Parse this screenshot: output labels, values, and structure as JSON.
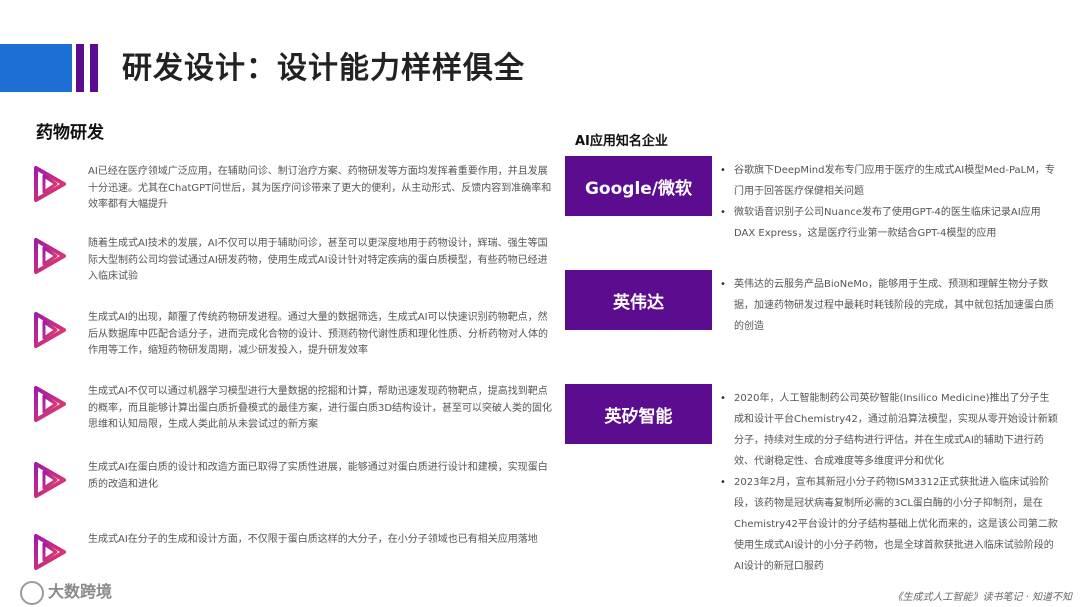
{
  "title": "研发设计：设计能力样样俱全",
  "section_title": "药物研发",
  "items": [
    {
      "icon": "play-triangle-icon",
      "text": "AI已经在医疗领域广泛应用，在辅助问诊、制订治疗方案、药物研发等方面均发挥着重要作用，并且发展十分迅速。尤其在ChatGPT问世后，其为医疗问诊带来了更大的便利，从主动形式、反馈内容到准确率和效率都有大幅提升"
    },
    {
      "icon": "play-triangle-icon",
      "text": "随着生成式AI技术的发展，AI不仅可以用于辅助问诊，甚至可以更深度地用于药物设计，辉瑞、强生等国际大型制药公司均尝试通过AI研发药物，使用生成式AI设计针对特定疾病的蛋白质模型，有些药物已经进入临床试验"
    },
    {
      "icon": "play-triangle-icon",
      "text": "生成式AI的出现，颠覆了传统药物研发进程。通过大量的数据筛选，生成式AI可以快速识别药物靶点，然后从数据库中匹配合适分子，进而完成化合物的设计、预测药物代谢性质和理化性质、分析药物对人体的作用等工作，缩短药物研发周期，减少研发投入，提升研发效率"
    },
    {
      "icon": "play-triangle-icon",
      "text": "生成式AI不仅可以通过机器学习模型进行大量数据的挖掘和计算，帮助迅速发现药物靶点，提高找到靶点的概率，而且能够计算出蛋白质折叠模式的最佳方案，进行蛋白质3D结构设计，甚至可以突破人类的固化思维和认知局限，生成人类此前从未尝试过的新方案"
    },
    {
      "icon": "play-triangle-icon",
      "text": "生成式AI在蛋白质的设计和改造方面已取得了实质性进展，能够通过对蛋白质进行设计和建模，实现蛋白质的改造和进化"
    },
    {
      "icon": "play-triangle-icon",
      "text": "生成式AI在分子的生成和设计方面，不仅限于蛋白质这样的大分子，在小分子领域也已有相关应用落地"
    }
  ],
  "companies_label": "AI应用知名企业",
  "companies": [
    {
      "name": "Google/微软",
      "bullets": [
        "谷歌旗下DeepMind发布专门应用于医疗的生成式AI模型Med-PaLM，专门用于回答医疗保健相关问题",
        "微软语音识别子公司Nuance发布了使用GPT-4的医生临床记录AI应用DAX Express，这是医疗行业第一款结合GPT-4模型的应用"
      ]
    },
    {
      "name": "英伟达",
      "bullets": [
        "英伟达的云服务产品BioNeMo，能够用于生成、预测和理解生物分子数据，加速药物研发过程中最耗时耗钱阶段的完成，其中就包括加速蛋白质的创造"
      ]
    },
    {
      "name": "英矽智能",
      "bullets": [
        "2020年，人工智能制药公司英矽智能(Insilico Medicine)推出了分子生成和设计平台Chemistry42，通过前沿算法模型，实现从零开始设计新颖分子，持续对生成的分子结构进行评估，并在生成式AI的辅助下进行药效、代谢稳定性、合成难度等多维度评分和优化",
        "2023年2月，宣布其新冠小分子药物ISM3312正式获批进入临床试验阶段，该药物是冠状病毒复制所必需的3CL蛋白酶的小分子抑制剂，是在Chemistry42平台设计的分子结构基础上优化而来的，这是该公司第二款使用生成式AI设计的小分子药物，也是全球首款获批进入临床试验阶段的AI设计的新冠口服药"
      ]
    }
  ],
  "watermark_left": "大数跨境",
  "watermark_right": "《生成式人工智能》读书笔记 · 知道不知",
  "colors": {
    "purple": "#5c0c8f",
    "blue": "#1d6fd6",
    "icon_gradient_start": "#b21aa0",
    "icon_gradient_end": "#e83a6a"
  }
}
